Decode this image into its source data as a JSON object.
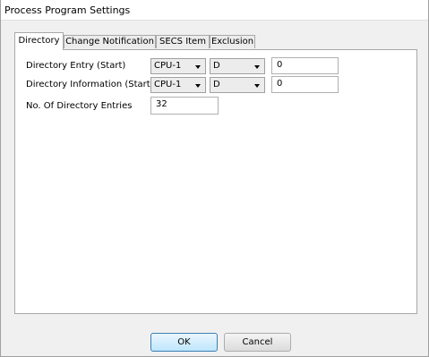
{
  "window": {
    "title": "Process Program Settings"
  },
  "tabs": [
    {
      "label": "Directory"
    },
    {
      "label": "Change Notification"
    },
    {
      "label": "SECS Item"
    },
    {
      "label": "Exclusion"
    }
  ],
  "directory": {
    "entry_start": {
      "label": "Directory Entry (Start)",
      "cpu": "CPU-1",
      "device": "D",
      "value": "0"
    },
    "info_start": {
      "label": "Directory Information (Start)",
      "cpu": "CPU-1",
      "device": "D",
      "value": "0"
    },
    "num_entries": {
      "label": "No. Of Directory Entries",
      "value": "32"
    }
  },
  "buttons": {
    "ok": "OK",
    "cancel": "Cancel"
  }
}
